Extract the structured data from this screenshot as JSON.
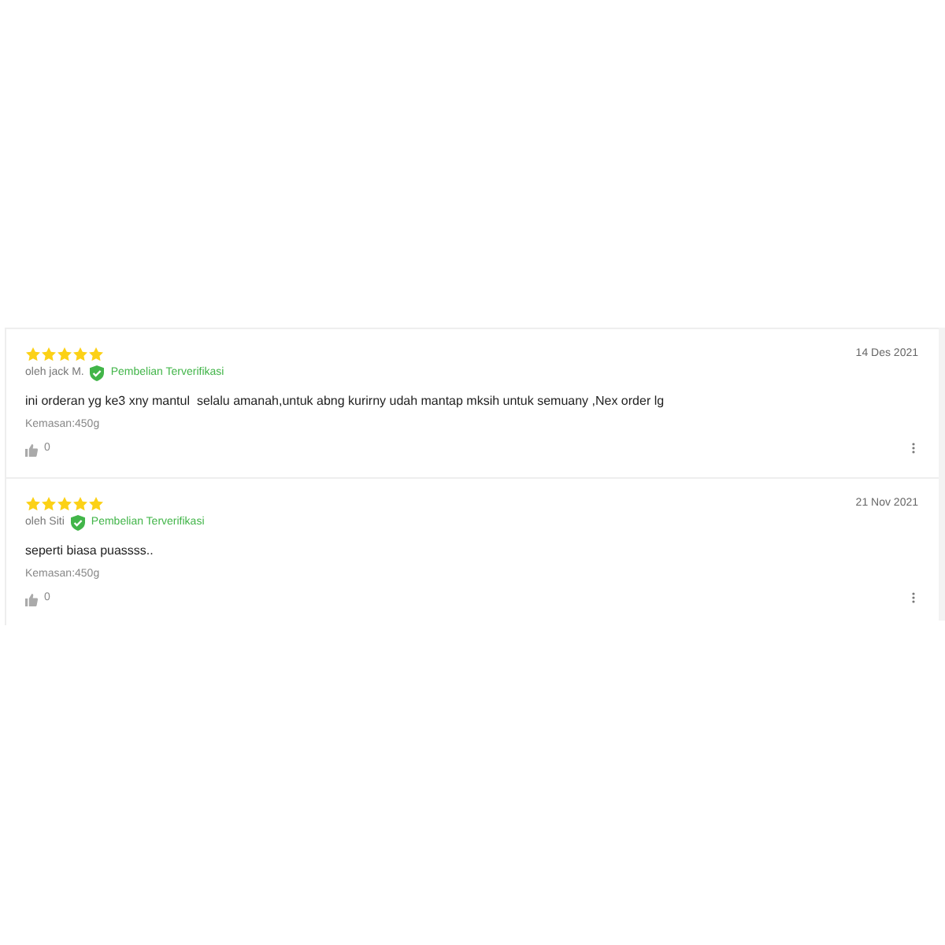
{
  "reviews": [
    {
      "stars": 5,
      "author": "oleh jack M.",
      "verified": true,
      "verified_label": "Pembelian Terverifikasi",
      "date": "14 Des 2021",
      "comment": "ini orderan yg ke3 xny mantul  selalu amanah,untuk abng kurirny udah mantap mksih untuk semuany ,Nex order lg",
      "variant": "Kemasan:450g",
      "likes": "0"
    },
    {
      "stars": 5,
      "author": "oleh Siti",
      "verified": true,
      "verified_label": "Pembelian Terverifikasi",
      "date": "21 Nov 2021",
      "comment": "seperti biasa puassss..",
      "variant": "Kemasan:450g",
      "likes": "0"
    }
  ]
}
